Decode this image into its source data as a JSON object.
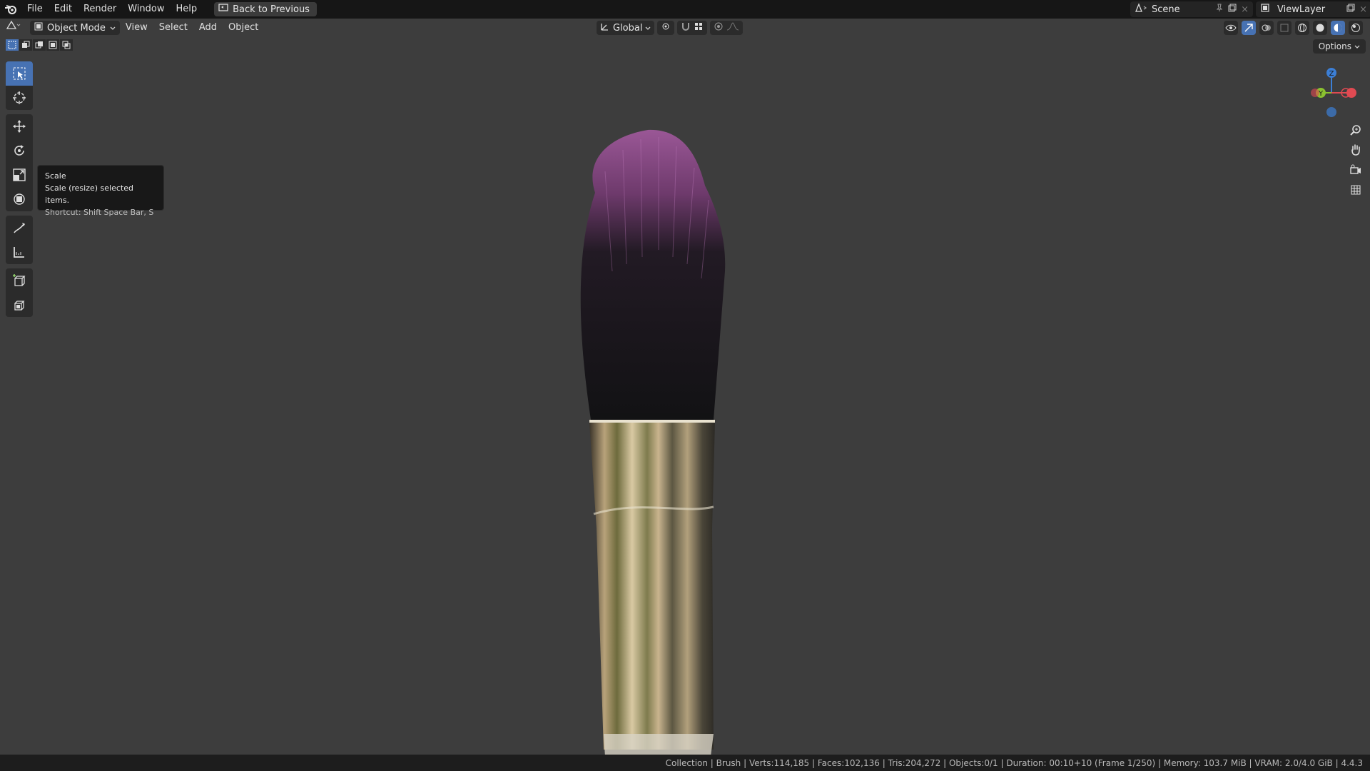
{
  "menubar": {
    "items": [
      "File",
      "Edit",
      "Render",
      "Window",
      "Help"
    ],
    "back_button": "Back to Previous",
    "scene_name": "Scene",
    "view_layer_name": "ViewLayer"
  },
  "viewport_header": {
    "mode": "Object Mode",
    "menus": [
      "View",
      "Select",
      "Add",
      "Object"
    ],
    "transform_orientation": "Global",
    "options_label": "Options"
  },
  "toolbar": {
    "tools": [
      "select-box",
      "cursor",
      "move",
      "rotate",
      "scale",
      "transform",
      "annotate",
      "measure",
      "add-cube",
      "extrude"
    ],
    "active_tool": "select-box"
  },
  "tooltip": {
    "title": "Scale",
    "description": "Scale (resize) selected items.",
    "shortcut": "Shortcut: Shift Space Bar, S"
  },
  "gizmo": {
    "x_label": "X",
    "y_label": "Y",
    "z_label": "Z"
  },
  "statusbar": {
    "text": "Collection | Brush | Verts:114,185 | Faces:102,136 | Tris:204,272 | Objects:0/1 | Duration: 00:10+10 (Frame 1/250) | Memory: 103.7 MiB | VRAM: 2.0/4.0 GiB | 4.4.3"
  },
  "colors": {
    "accent": "#4772b3",
    "viewport_bg": "#3d3d3d",
    "bristle_tip": "#8a4b86",
    "axis_x": "#e04a52",
    "axis_y": "#8bc230",
    "axis_z": "#3c7fd6"
  }
}
